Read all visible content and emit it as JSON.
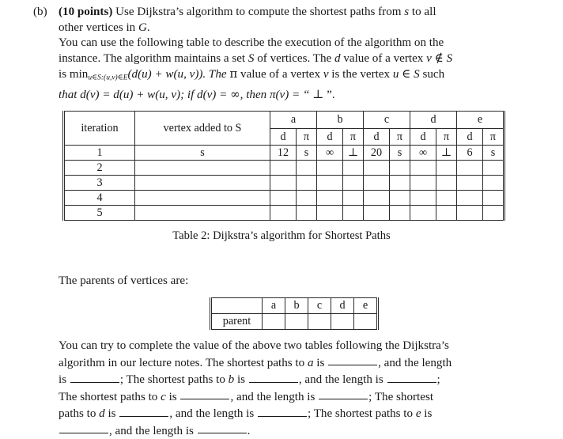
{
  "problem": {
    "label": "(b)",
    "points": "(10 points)",
    "line1_rest": " Use Dijkstra’s algorithm to compute the shortest paths from ",
    "var_s": "s",
    "line1_tail": " to all",
    "line2_a": "other vertices in ",
    "var_G": "G",
    "line2_tail": ".",
    "line3": "You can use the following table to describe the execution of the algorithm on the",
    "line4_a": "instance. The algorithm maintains a set ",
    "var_S1": "S",
    "line4_b": " of vertices. The ",
    "var_d1": "d",
    "line4_c": " value of a vertex ",
    "var_v1": "v",
    "line4_d": " ∉ ",
    "var_S2": "S",
    "line5_a": "is min",
    "line5_sub": "u∈S:(u,v)∈E",
    "line5_b": "(d(u) + w(u, v)). The ",
    "pi_sym": "π",
    "line5_c": " value of a vertex ",
    "var_v2": "v",
    "line5_d": " is the vertex ",
    "var_u": "u",
    "line5_e": " ∈ ",
    "var_S3": "S",
    "line5_f": " such",
    "line6_a": "that d(v) = d(u) + w(u, v); if d(v) = ",
    "infinity": "∞",
    "line6_b": ", then π(v) = “ ",
    "perp": "⊥",
    "line6_c": " ”."
  },
  "main_table": {
    "header": {
      "iteration": "iteration",
      "vertex_added": "vertex added to S",
      "vertices": [
        "a",
        "b",
        "c",
        "d",
        "e"
      ],
      "sub_d": "d",
      "sub_pi": "π"
    },
    "rows": [
      {
        "iteration": "1",
        "vertex_added": "s",
        "cells": [
          {
            "d": "12",
            "pi": "s"
          },
          {
            "d": "∞",
            "pi": "⊥"
          },
          {
            "d": "20",
            "pi": "s"
          },
          {
            "d": "∞",
            "pi": "⊥"
          },
          {
            "d": "6",
            "pi": "s"
          }
        ]
      },
      {
        "iteration": "2",
        "vertex_added": "",
        "cells": [
          {
            "d": "",
            "pi": ""
          },
          {
            "d": "",
            "pi": ""
          },
          {
            "d": "",
            "pi": ""
          },
          {
            "d": "",
            "pi": ""
          },
          {
            "d": "",
            "pi": ""
          }
        ]
      },
      {
        "iteration": "3",
        "vertex_added": "",
        "cells": [
          {
            "d": "",
            "pi": ""
          },
          {
            "d": "",
            "pi": ""
          },
          {
            "d": "",
            "pi": ""
          },
          {
            "d": "",
            "pi": ""
          },
          {
            "d": "",
            "pi": ""
          }
        ]
      },
      {
        "iteration": "4",
        "vertex_added": "",
        "cells": [
          {
            "d": "",
            "pi": ""
          },
          {
            "d": "",
            "pi": ""
          },
          {
            "d": "",
            "pi": ""
          },
          {
            "d": "",
            "pi": ""
          },
          {
            "d": "",
            "pi": ""
          }
        ]
      },
      {
        "iteration": "5",
        "vertex_added": "",
        "cells": [
          {
            "d": "",
            "pi": ""
          },
          {
            "d": "",
            "pi": ""
          },
          {
            "d": "",
            "pi": ""
          },
          {
            "d": "",
            "pi": ""
          },
          {
            "d": "",
            "pi": ""
          }
        ]
      }
    ]
  },
  "caption": "Table 2: Dijkstra’s algorithm for Shortest Paths",
  "parents_line": "The parents of vertices are:",
  "parent_table": {
    "corner": "",
    "columns": [
      "a",
      "b",
      "c",
      "d",
      "e"
    ],
    "row_label": "parent",
    "values": [
      "",
      "",
      "",
      "",
      ""
    ]
  },
  "final_para": {
    "s1": "You can try to complete the value of the above two tables following the Dijkstra’s",
    "s2": "algorithm in our lecture notes. The shortest paths to ",
    "v_a": "a",
    "s3": " is ",
    "s4": ", and the length",
    "s5": "is ",
    "s6": "; The shortest paths to ",
    "v_b": "b",
    "s7": " is ",
    "s8": ", and the length is ",
    "s9": ";",
    "s10": "The shortest paths to ",
    "v_c": "c",
    "s11": " is ",
    "s12": ", and the length is ",
    "s13": "; The shortest",
    "s14": "paths to ",
    "v_d": "d",
    "s15": " is ",
    "s16": ", and the length is ",
    "s17": "; The shortest paths to ",
    "v_e": "e",
    "s18": " is",
    "s19": ", and the length is ",
    "s20": "."
  }
}
